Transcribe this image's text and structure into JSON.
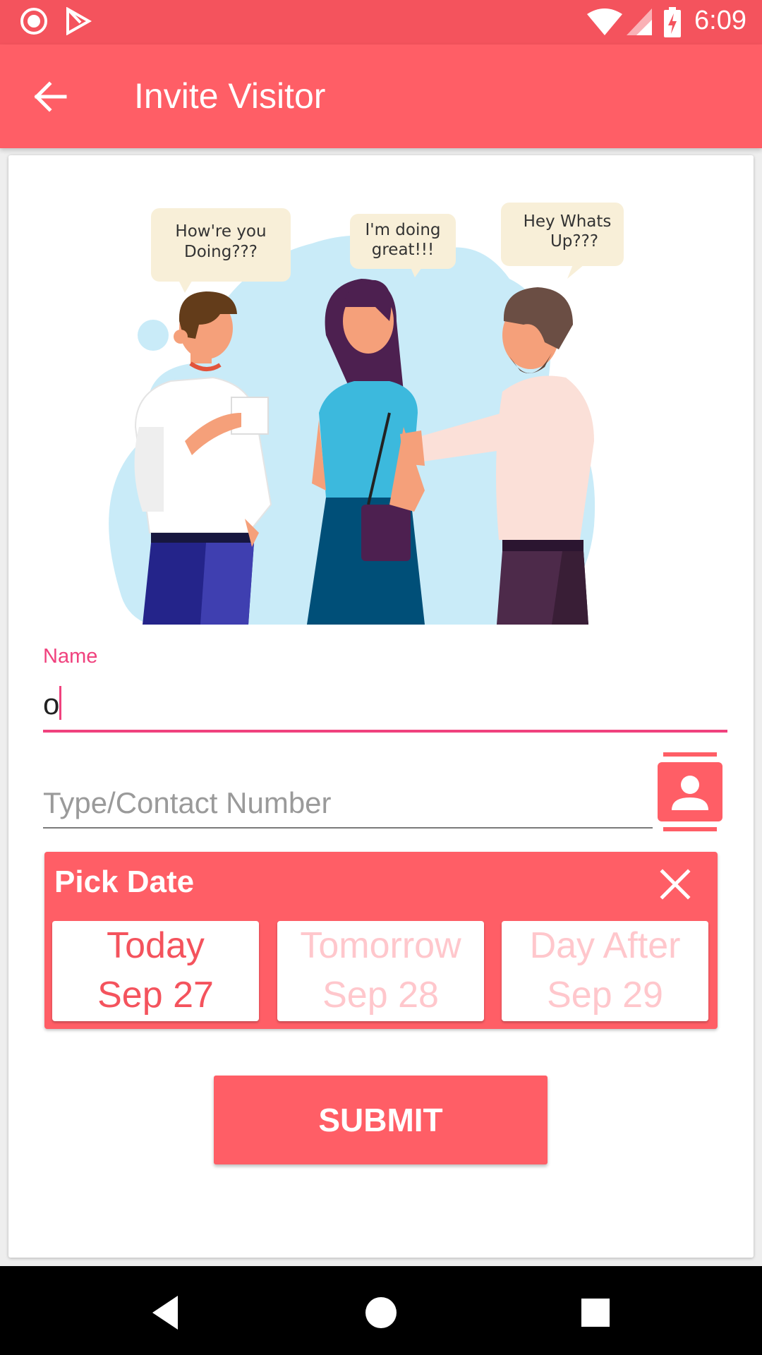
{
  "status_bar": {
    "time": "6:09",
    "icons": [
      "record-icon",
      "play-store-icon",
      "wifi-icon",
      "signal-icon",
      "battery-charging-icon"
    ]
  },
  "app_bar": {
    "title": "Invite Visitor",
    "back_icon": "arrow-back-icon"
  },
  "illustration": {
    "bubbles": [
      {
        "line1": "How're you",
        "line2": "Doing???"
      },
      {
        "line1": "I'm doing",
        "line2": "great!!!"
      },
      {
        "line1": "Hey Whats",
        "line2": "Up???"
      }
    ]
  },
  "form": {
    "name_label": "Name",
    "name_value": "o",
    "phone_placeholder": "Type/Contact Number",
    "contact_icon": "contact-book-icon"
  },
  "pick_date": {
    "title": "Pick Date",
    "close_icon": "close-icon",
    "options": [
      {
        "day": "Today",
        "date": "Sep 27",
        "selected": true
      },
      {
        "day": "Tomorrow",
        "date": "Sep 28",
        "selected": false
      },
      {
        "day": "Day After",
        "date": "Sep 29",
        "selected": false
      }
    ]
  },
  "submit_label": "SUBMIT",
  "colors": {
    "primary": "#ff5e66",
    "status_bar": "#f4535d",
    "accent": "#f0427e",
    "inactive_date_text": "#ffc7cc"
  },
  "nav_bar": {
    "icons": [
      "nav-back-icon",
      "nav-home-icon",
      "nav-recents-icon"
    ]
  }
}
